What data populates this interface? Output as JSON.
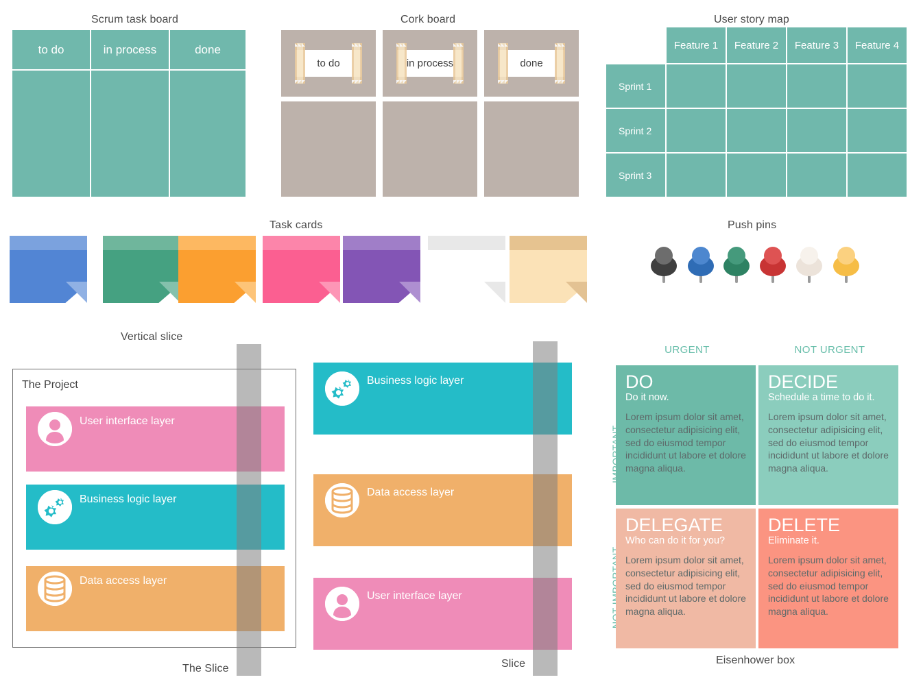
{
  "scrum_board": {
    "caption": "Scrum task board",
    "columns": [
      "to do",
      "in process",
      "done"
    ]
  },
  "cork_board": {
    "caption": "Cork board",
    "columns": [
      "to do",
      "in process",
      "done"
    ]
  },
  "story_map": {
    "caption": "User story map",
    "features": [
      "Feature 1",
      "Feature 2",
      "Feature 3",
      "Feature 4"
    ],
    "sprints": [
      "Sprint 1",
      "Sprint 2",
      "Sprint 3"
    ]
  },
  "task_cards": {
    "caption": "Task cards",
    "cards": [
      {
        "name": "blue",
        "body": "#5285d4",
        "strip": "#7ba2de",
        "fold": "#90b1e4"
      },
      {
        "name": "green",
        "body": "#45a181",
        "strip": "#6fb69c",
        "fold": "#84c1ac"
      },
      {
        "name": "orange",
        "body": "#fb9f30",
        "strip": "#fdb861",
        "fold": "#fdc478"
      },
      {
        "name": "pink",
        "body": "#fb5f91",
        "strip": "#fc85aa",
        "fold": "#fd96b6"
      },
      {
        "name": "purple",
        "body": "#8355b5",
        "strip": "#a07ec8",
        "fold": "#ae8fd1"
      },
      {
        "name": "white",
        "body": "#ffffff",
        "strip": "#e8e8e8",
        "fold": "#e8e8e8"
      },
      {
        "name": "cream",
        "body": "#fbe2b7",
        "strip": "#e6c390",
        "fold": "#e3c293"
      }
    ]
  },
  "push_pins": {
    "caption": "Push pins",
    "pins": [
      {
        "name": "dark-gray",
        "base": "#3f3f3f",
        "head": "#6d6d6d"
      },
      {
        "name": "blue",
        "base": "#2f6cb5",
        "head": "#4d87cf"
      },
      {
        "name": "green",
        "base": "#2e8263",
        "head": "#459a7c"
      },
      {
        "name": "red",
        "base": "#c83434",
        "head": "#de5353"
      },
      {
        "name": "cream",
        "base": "#ece3da",
        "head": "#f7f2ec"
      },
      {
        "name": "yellow",
        "base": "#f6bd46",
        "head": "#fbd180"
      }
    ]
  },
  "vertical_slice": {
    "caption": "Vertical slice",
    "project_label": "The Project",
    "slice_label": "The Slice",
    "layers": [
      {
        "label": "User interface layer",
        "color": "#ef8cb8",
        "icon": "person-icon"
      },
      {
        "label": "Business logic layer",
        "color": "#24bcc8",
        "icon": "gears-icon"
      },
      {
        "label": "Data access layer",
        "color": "#f0b06a",
        "icon": "database-icon"
      }
    ]
  },
  "slice_panel": {
    "slice_label": "Slice",
    "layers": [
      {
        "label": "Business logic layer",
        "color": "#24bcc8",
        "icon": "gears-icon"
      },
      {
        "label": "Data access layer",
        "color": "#f0b06a",
        "icon": "database-icon"
      },
      {
        "label": "User interface layer",
        "color": "#ef8cb8",
        "icon": "person-icon"
      }
    ]
  },
  "eisenhower": {
    "caption": "Eisenhower box",
    "col_headers": [
      "URGENT",
      "NOT URGENT"
    ],
    "row_headers": [
      "IMPORTANT",
      "NOT IMPORTANT"
    ],
    "body_text": "Lorem ipsum dolor sit amet, consectetur adipisicing elit, sed do eiusmod tempor incididunt ut labore et dolore magna aliqua.",
    "quadrants": [
      {
        "title": "DO",
        "subtitle": "Do it now.",
        "color": "#6dbaa8"
      },
      {
        "title": "DECIDE",
        "subtitle": "Schedule a time to do it.",
        "color": "#8bcdbd"
      },
      {
        "title": "DELEGATE",
        "subtitle": "Who can do it for you?",
        "color": "#f0b9a4"
      },
      {
        "title": "DELETE",
        "subtitle": "Eliminate it.",
        "color": "#fb9481"
      }
    ]
  },
  "colors": {
    "teal": "#70b8ac",
    "cork": "#bdb2ab",
    "slice_gray": "#808080",
    "caption_text": "#4a4a4a"
  }
}
